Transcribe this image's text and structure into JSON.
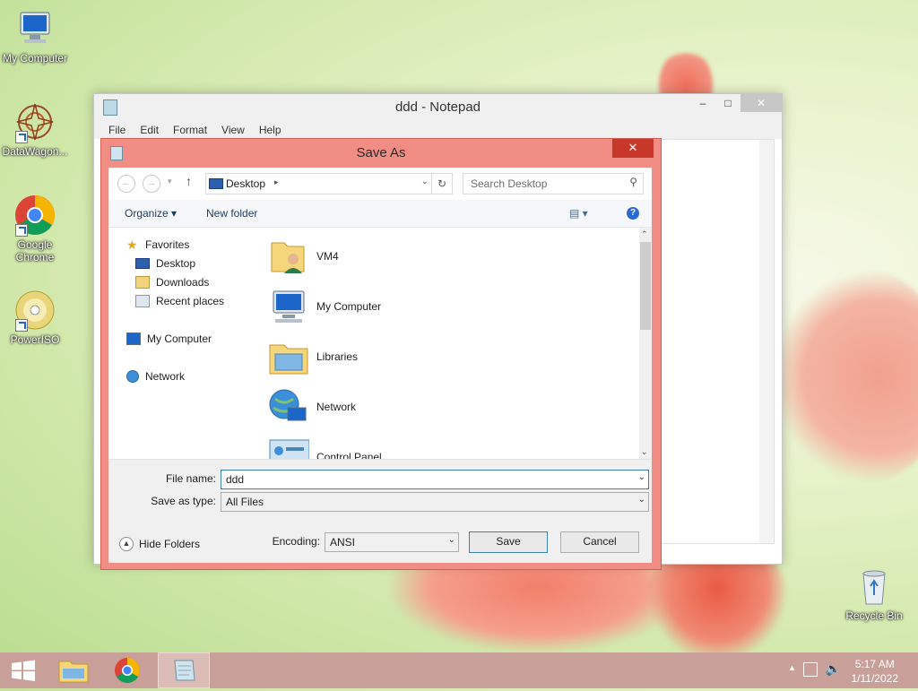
{
  "desktop": {
    "icons": [
      {
        "label": "My Computer"
      },
      {
        "label": "DataWagon..."
      },
      {
        "label": "Google Chrome"
      },
      {
        "label": "PowerISO"
      },
      {
        "label": "Recycle Bin"
      }
    ]
  },
  "notepad": {
    "title": "ddd - Notepad",
    "menu": [
      "File",
      "Edit",
      "Format",
      "View",
      "Help"
    ]
  },
  "dialog": {
    "title": "Save As",
    "address": "Desktop",
    "search_placeholder": "Search Desktop",
    "toolbar": {
      "organize": "Organize",
      "new_folder": "New folder"
    },
    "nav": {
      "favorites": "Favorites",
      "desktop": "Desktop",
      "downloads": "Downloads",
      "recent": "Recent places",
      "my_computer": "My Computer",
      "network": "Network"
    },
    "items": [
      {
        "label": "VM4"
      },
      {
        "label": "My Computer"
      },
      {
        "label": "Libraries"
      },
      {
        "label": "Network"
      },
      {
        "label": "Control Panel"
      }
    ],
    "file_name_label": "File name:",
    "file_name_value": "ddd",
    "save_type_label": "Save as type:",
    "save_type_value": "All Files",
    "encoding_label": "Encoding:",
    "encoding_value": "ANSI",
    "save_button": "Save",
    "cancel_button": "Cancel",
    "hide_folders": "Hide Folders"
  },
  "taskbar": {
    "time": "5:17 AM",
    "date": "1/11/2022"
  }
}
